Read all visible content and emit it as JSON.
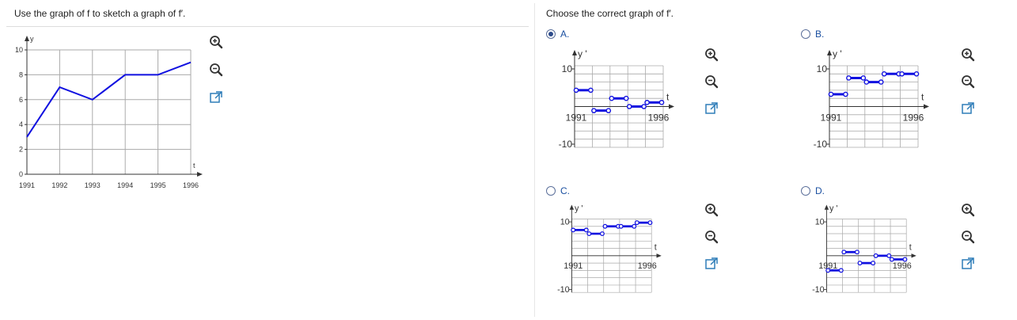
{
  "prompt": "Use the graph of f to sketch a graph of f′.",
  "question": "Choose the correct graph of f′.",
  "main_graph": {
    "y_axis_label": "y",
    "t_axis_label": "t",
    "y_ticks": [
      "10",
      "8",
      "6",
      "4",
      "2",
      "0"
    ],
    "x_ticks": [
      "1991",
      "1992",
      "1993",
      "1994",
      "1995",
      "1996"
    ],
    "points": [
      [
        1991,
        3
      ],
      [
        1992,
        7
      ],
      [
        1993,
        6
      ],
      [
        1994,
        8
      ],
      [
        1995,
        8
      ],
      [
        1996,
        9
      ]
    ]
  },
  "options": [
    {
      "letter": "A.",
      "selected": true,
      "y_label": "y '",
      "y_top": "10",
      "y_bottom": "-10",
      "t_label": "t",
      "x_start": "1991",
      "x_end": "1996",
      "segments": [
        [
          0,
          1,
          4
        ],
        [
          1,
          2,
          -1
        ],
        [
          2,
          3,
          2
        ],
        [
          3,
          4,
          0
        ],
        [
          4,
          5,
          1
        ]
      ]
    },
    {
      "letter": "B.",
      "selected": false,
      "y_label": "y '",
      "y_top": "10",
      "y_bottom": "-10",
      "t_label": "t",
      "x_start": "1991",
      "x_end": "1996",
      "segments": [
        [
          0,
          1,
          3
        ],
        [
          1,
          2,
          7
        ],
        [
          2,
          3,
          6
        ],
        [
          3,
          4,
          8
        ],
        [
          4,
          5,
          8
        ]
      ]
    },
    {
      "letter": "C.",
      "selected": false,
      "y_label": "y '",
      "y_top": "10",
      "y_bottom": "-10",
      "t_label": "t",
      "x_start": "1991",
      "x_end": "1996",
      "segments": [
        [
          0,
          1,
          7
        ],
        [
          1,
          2,
          6
        ],
        [
          2,
          3,
          8
        ],
        [
          3,
          4,
          8
        ],
        [
          4,
          5,
          9
        ]
      ]
    },
    {
      "letter": "D.",
      "selected": false,
      "y_label": "y '",
      "y_top": "10",
      "y_bottom": "-10",
      "t_label": "t",
      "x_start": "1991",
      "x_end": "1996",
      "segments": [
        [
          0,
          1,
          -4
        ],
        [
          1,
          2,
          1
        ],
        [
          2,
          3,
          -2
        ],
        [
          3,
          4,
          0
        ],
        [
          4,
          5,
          -1
        ]
      ]
    }
  ],
  "icons": {
    "zoom_in": "zoom-in-icon",
    "zoom_out": "zoom-out-icon",
    "popout": "popout-icon"
  },
  "colors": {
    "curve": "#1010e0",
    "grid": "#aaaaaa",
    "accent": "#2c4a8a"
  }
}
